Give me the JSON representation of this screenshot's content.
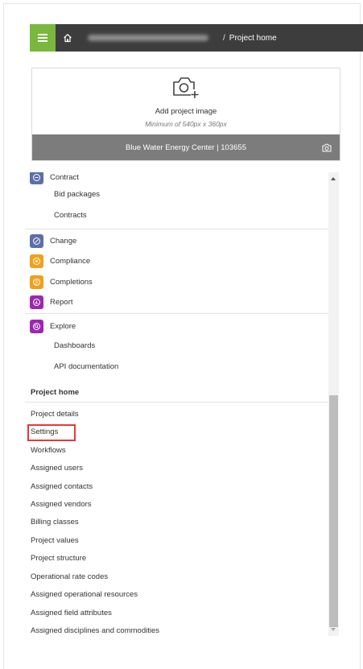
{
  "breadcrumb": {
    "separator": "/",
    "current": "Project home"
  },
  "project_image": {
    "add_label": "Add project image",
    "min_size": "Minimum of 540px x 360px",
    "project_name": "Blue Water Energy Center | 103655"
  },
  "modules": [
    {
      "label": "Contract",
      "color": "#5b6fa8",
      "icon": "contract-icon",
      "children": [
        "Bid packages",
        "Contracts"
      ]
    },
    {
      "label": "Change",
      "color": "#5b6fa8",
      "icon": "change-icon",
      "children": []
    },
    {
      "label": "Compliance",
      "color": "#f0a019",
      "icon": "compliance-icon",
      "children": []
    },
    {
      "label": "Completions",
      "color": "#f0a019",
      "icon": "completions-icon",
      "children": []
    },
    {
      "label": "Report",
      "color": "#9c27b0",
      "icon": "report-icon",
      "children": []
    },
    {
      "label": "Explore",
      "color": "#9c27b0",
      "icon": "explore-icon",
      "children": [
        "Dashboards",
        "API documentation"
      ]
    }
  ],
  "project_home": {
    "title": "Project home",
    "items": [
      "Project details",
      "Settings",
      "Workflows",
      "Assigned users",
      "Assigned contacts",
      "Assigned vendors",
      "Billing classes",
      "Project values",
      "Project structure",
      "Operational rate codes",
      "Assigned operational resources",
      "Assigned field attributes",
      "Assigned disciplines and commodities"
    ],
    "highlighted_item": "Settings"
  },
  "colors": {
    "header_bg": "#3d3d3d",
    "menu_accent": "#7ab73e",
    "card_footer": "#7c7c7c",
    "highlight_border": "#e53935"
  }
}
